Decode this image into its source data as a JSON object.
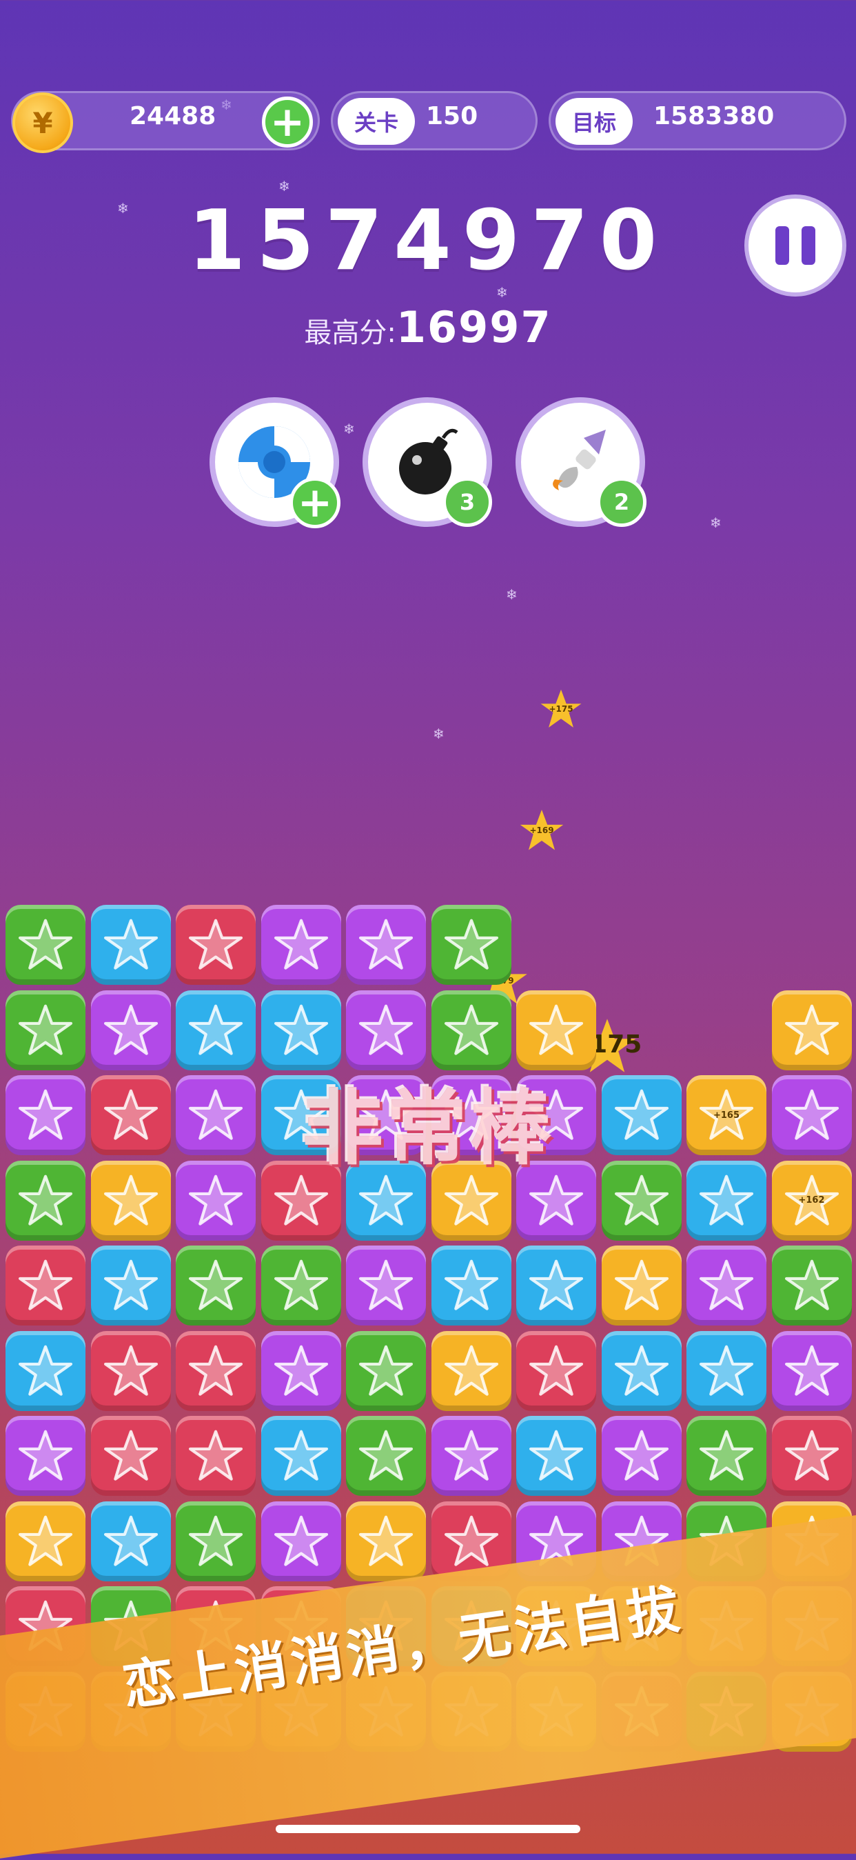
{
  "hud": {
    "coins": "24488",
    "coin_symbol": "¥",
    "level_label": "关卡",
    "level_value": "150",
    "target_label": "目标",
    "target_value": "1583380"
  },
  "score": "1574970",
  "best": {
    "label": "最高分:",
    "value": "16997"
  },
  "tools": [
    {
      "name": "refresh",
      "badge": "+"
    },
    {
      "name": "bomb",
      "badge": "3"
    },
    {
      "name": "brush",
      "badge": "2"
    }
  ],
  "floating": [
    "+175",
    "+169",
    "+179",
    "+175"
  ],
  "tile_scores": {
    "r2c8": "+165",
    "r3c9": "+162"
  },
  "praise": "非常棒",
  "slogan": "恋上消消消，无法自拔",
  "colors": {
    "green": "#4fb534",
    "blue": "#2fb0ec",
    "red": "#dd3f5b",
    "purple": "#b24ae8",
    "yellow": "#f6b325"
  },
  "board": [
    [
      "G",
      "B",
      "R",
      "P",
      "P",
      "G",
      "-",
      "-",
      "-",
      "-"
    ],
    [
      "G",
      "P",
      "B",
      "B",
      "P",
      "G",
      "Y",
      "-",
      "-",
      "Y"
    ],
    [
      "P",
      "R",
      "P",
      "B",
      "P",
      "P",
      "P",
      "B",
      "Y",
      "P"
    ],
    [
      "G",
      "Y",
      "P",
      "R",
      "B",
      "Y",
      "P",
      "G",
      "B",
      "Y"
    ],
    [
      "R",
      "B",
      "G",
      "G",
      "P",
      "B",
      "B",
      "Y",
      "P",
      "G"
    ],
    [
      "B",
      "R",
      "R",
      "P",
      "G",
      "Y",
      "R",
      "B",
      "B",
      "P"
    ],
    [
      "P",
      "R",
      "R",
      "B",
      "G",
      "P",
      "B",
      "P",
      "G",
      "R"
    ],
    [
      "Y",
      "B",
      "G",
      "P",
      "Y",
      "R",
      "P",
      "P",
      "G",
      "Y"
    ],
    [
      "R",
      "G",
      "R",
      "R",
      "B",
      "B",
      "Y",
      "Y",
      "Y",
      "Y"
    ],
    [
      "Y",
      "Y",
      "Y",
      "Y",
      "Y",
      "Y",
      "Y",
      "R",
      "G",
      "Y"
    ]
  ]
}
